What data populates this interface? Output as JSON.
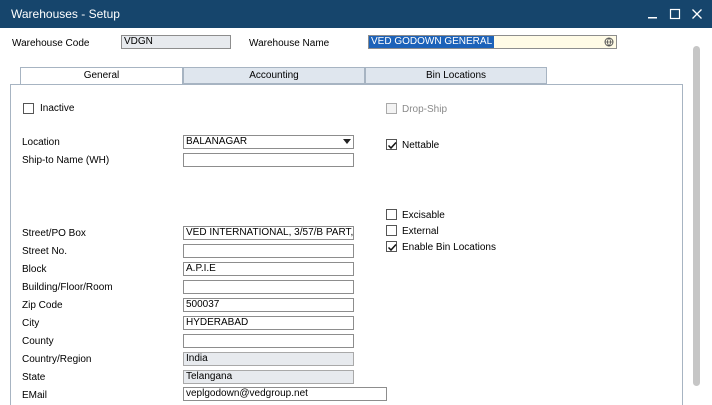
{
  "window": {
    "title": "Warehouses - Setup"
  },
  "header": {
    "warehouse_code_label": "Warehouse Code",
    "warehouse_code_value": "VDGN",
    "warehouse_name_label": "Warehouse Name",
    "warehouse_name_value": "VED GODOWN GENERAL"
  },
  "tabs": [
    {
      "label": "General",
      "active": true
    },
    {
      "label": "Accounting",
      "active": false
    },
    {
      "label": "Bin Locations",
      "active": false
    }
  ],
  "general": {
    "inactive_label": "Inactive",
    "inactive_checked": false,
    "location_label": "Location",
    "location_value": "BALANAGAR",
    "ship_to_label": "Ship-to Name (WH)",
    "ship_to_value": "",
    "street_label": "Street/PO Box",
    "street_value": "VED INTERNATIONAL, 3/57/B PART,",
    "street_no_label": "Street No.",
    "street_no_value": "",
    "block_label": "Block",
    "block_value": "A.P.I.E",
    "building_label": "Building/Floor/Room",
    "building_value": "",
    "zip_label": "Zip Code",
    "zip_value": "500037",
    "city_label": "City",
    "city_value": "HYDERABAD",
    "county_label": "County",
    "county_value": "",
    "country_label": "Country/Region",
    "country_value": "India",
    "state_label": "State",
    "state_value": "Telangana",
    "email_label": "EMail",
    "email_value": "veplgodown@vedgroup.net",
    "drop_ship_label": "Drop-Ship",
    "drop_ship_checked": false,
    "nettable_label": "Nettable",
    "nettable_checked": true,
    "excisable_label": "Excisable",
    "excisable_checked": false,
    "external_label": "External",
    "external_checked": false,
    "enable_bin_label": "Enable Bin Locations",
    "enable_bin_checked": true
  },
  "colors": {
    "titlebar": "#16456c",
    "tab_inactive": "#dfe6ee",
    "readonly_field": "#e7eaee",
    "selection": "#1c62b9"
  }
}
